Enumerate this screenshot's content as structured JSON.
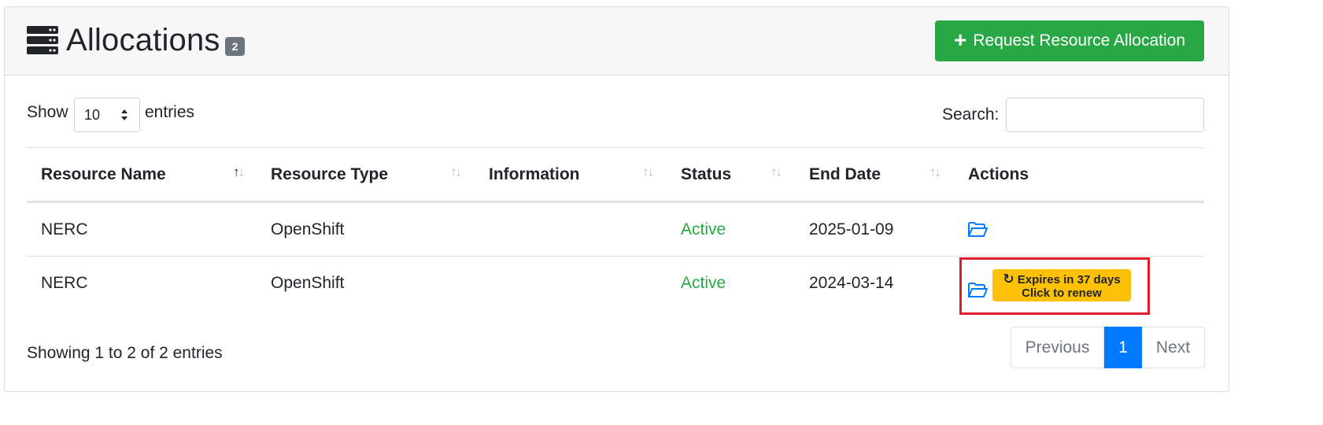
{
  "header": {
    "title": "Allocations",
    "count_badge": "2",
    "request_button_label": "Request Resource Allocation",
    "icon": "server-icon"
  },
  "controls": {
    "show_label": "Show",
    "page_length_value": "10",
    "entries_label": "entries",
    "search_label": "Search:",
    "search_value": ""
  },
  "table": {
    "columns": [
      "Resource Name",
      "Resource Type",
      "Information",
      "Status",
      "End Date",
      "Actions"
    ],
    "rows": [
      {
        "resource_name": "NERC",
        "resource_type": "OpenShift",
        "information": "",
        "status": "Active",
        "end_date": "2025-01-09",
        "actions": [
          "folder-open-icon"
        ]
      },
      {
        "resource_name": "NERC",
        "resource_type": "OpenShift",
        "information": "",
        "status": "Active",
        "end_date": "2024-03-14",
        "actions": [
          "folder-open-icon",
          "renew-button"
        ],
        "renew_line1": "Expires in 37 days",
        "renew_line2": "Click to renew"
      }
    ]
  },
  "footer": {
    "info": "Showing 1 to 2 of 2 entries",
    "pagination": {
      "previous_label": "Previous",
      "current_page": "1",
      "next_label": "Next"
    }
  },
  "colors": {
    "primary": "#007bff",
    "success": "#28a745",
    "warning": "#ffc107",
    "secondary": "#6c757d",
    "highlight": "#e21c2a"
  }
}
